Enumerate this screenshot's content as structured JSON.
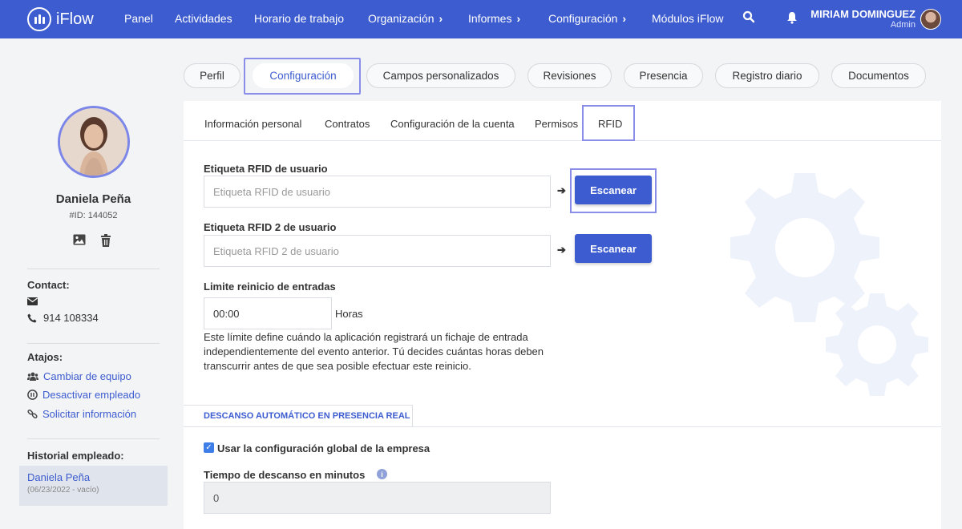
{
  "app": {
    "logo_text": "iFlow"
  },
  "nav": {
    "items": [
      {
        "label": "Panel",
        "chevron": ""
      },
      {
        "label": "Actividades",
        "chevron": ""
      },
      {
        "label": "Horario de trabajo",
        "chevron": ""
      },
      {
        "label": "Organización",
        "chevron": "›"
      },
      {
        "label": "Informes",
        "chevron": "›"
      },
      {
        "label": "Configuración",
        "chevron": "›"
      },
      {
        "label": "Módulos iFlow",
        "chevron": ""
      }
    ],
    "user_name": "MIRIAM DOMINGUEZ",
    "user_role": "Admin"
  },
  "sidebar": {
    "employee_name": "Daniela Peña",
    "employee_id": "#ID: 144052",
    "contact_heading": "Contact:",
    "phone": "914 108334",
    "shortcuts_heading": "Atajos:",
    "shortcuts": [
      {
        "label": "Cambiar de equipo",
        "icon": "users-icon"
      },
      {
        "label": "Desactivar empleado",
        "icon": "pause-icon"
      },
      {
        "label": "Solicitar información",
        "icon": "link-icon"
      }
    ],
    "history_heading": "Historial empleado:",
    "history_name": "Daniela Peña",
    "history_date": "(06/23/2022 - vacío)"
  },
  "tabs": [
    {
      "label": "Perfil",
      "active": false
    },
    {
      "label": "Configuración",
      "active": true
    },
    {
      "label": "Campos personalizados",
      "active": false
    },
    {
      "label": "Revisiones",
      "active": false
    },
    {
      "label": "Presencia",
      "active": false
    },
    {
      "label": "Registro diario",
      "active": false
    },
    {
      "label": "Documentos",
      "active": false
    }
  ],
  "subtabs": [
    {
      "label": "Información personal"
    },
    {
      "label": "Contratos"
    },
    {
      "label": "Configuración de la cuenta"
    },
    {
      "label": "Permisos"
    },
    {
      "label": "RFID"
    }
  ],
  "form": {
    "rfid1_label": "Etiqueta RFID de usuario",
    "rfid1_placeholder": "Etiqueta RFID de usuario",
    "rfid2_label": "Etiqueta RFID 2 de usuario",
    "rfid2_placeholder": "Etiqueta RFID 2 de usuario",
    "scan_label": "Escanear",
    "limit_label": "Limite reinicio de entradas",
    "limit_value": "00:00",
    "limit_unit": "Horas",
    "limit_help": "Este límite define cuándo la aplicación registrará un fichaje de entrada independientemente del evento anterior. Tú decides cuántas horas deben transcurrir antes de que sea posible efectuar este reinicio.",
    "section_title": "DESCANSO AUTOMÁTICO EN PRESENCIA REAL",
    "use_global_label": "Usar la configuración global de la empresa",
    "use_global_checked": true,
    "break_label": "Tiempo de descanso en minutos",
    "break_value": "0"
  },
  "colors": {
    "primary": "#3d5ccf",
    "highlight": "#8b8ee8",
    "gears": "#eef2fb"
  }
}
